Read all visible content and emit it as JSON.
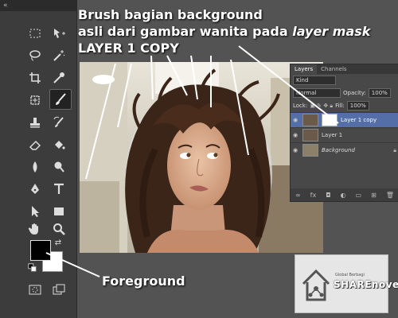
{
  "toolbar": {
    "collapse_label": "«",
    "tools": [
      "marquee-tool",
      "move-tool",
      "lasso-tool",
      "magic-wand-tool",
      "crop-tool",
      "eyedropper-tool",
      "healing-brush-tool",
      "brush-tool",
      "clone-stamp-tool",
      "history-brush-tool",
      "eraser-tool",
      "paint-bucket-tool",
      "blur-tool",
      "dodge-tool",
      "pen-tool",
      "type-tool",
      "path-selection-tool",
      "shape-tool",
      "hand-tool",
      "zoom-tool"
    ],
    "active_tool": "brush-tool",
    "foreground_color": "#000000",
    "background_color": "#ffffff"
  },
  "annotations": {
    "line1": "Brush bagian background",
    "line2_prefix": "asli dari gambar wanita pada ",
    "line2_italic": "layer mask",
    "line3": "LAYER 1 COPY",
    "foreground_label": "Foreground"
  },
  "layers_panel": {
    "tabs": [
      "Layers",
      "Channels"
    ],
    "filter_kind": "Kind",
    "blend_mode": "Normal",
    "opacity_label": "Opacity:",
    "opacity_value": "100%",
    "lock_label": "Lock:",
    "fill_label": "Fill:",
    "fill_value": "100%",
    "layers": [
      {
        "name": "Layer 1 copy",
        "selected": true,
        "has_mask": true
      },
      {
        "name": "Layer 1",
        "selected": false,
        "has_mask": false
      },
      {
        "name": "Background",
        "selected": false,
        "has_mask": false,
        "italic": true
      }
    ],
    "footer_icons": [
      "link-icon",
      "fx-icon",
      "mask-icon",
      "adjustment-icon",
      "folder-icon",
      "new-layer-icon",
      "trash-icon"
    ]
  },
  "logo": {
    "tagline": "Global Berbagi",
    "brand": "SHAREnovel"
  }
}
